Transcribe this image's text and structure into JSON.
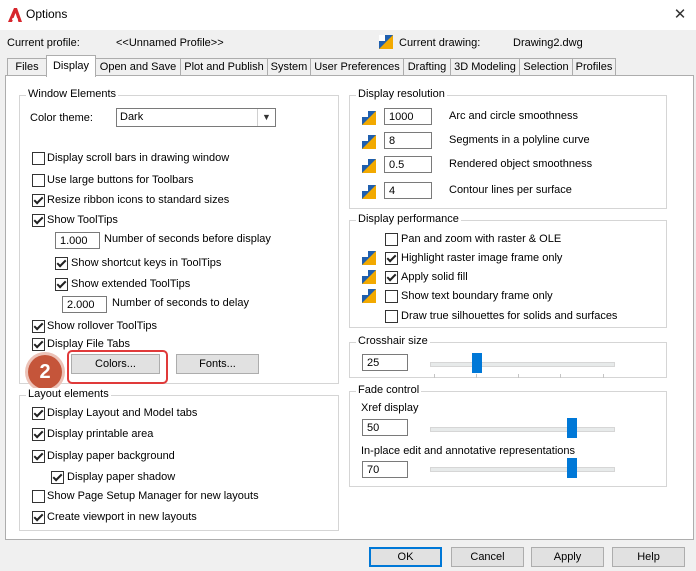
{
  "window": {
    "title": "Options",
    "close_glyph": "✕"
  },
  "profile": {
    "label": "Current profile:",
    "value": "<<Unnamed Profile>>",
    "drawing_label": "Current drawing:",
    "drawing_value": "Drawing2.dwg"
  },
  "tabs": [
    {
      "label": "Files"
    },
    {
      "label": "Display"
    },
    {
      "label": "Open and Save"
    },
    {
      "label": "Plot and Publish"
    },
    {
      "label": "System"
    },
    {
      "label": "User Preferences"
    },
    {
      "label": "Drafting"
    },
    {
      "label": "3D Modeling"
    },
    {
      "label": "Selection"
    },
    {
      "label": "Profiles"
    }
  ],
  "active_tab": "Display",
  "window_elements": {
    "title": "Window Elements",
    "color_theme_label": "Color theme:",
    "color_theme_value": "Dark",
    "items": [
      {
        "label": "Display scroll bars in drawing window",
        "checked": false
      },
      {
        "label": "Use large buttons for Toolbars",
        "checked": false
      },
      {
        "label": "Resize ribbon icons to standard sizes",
        "checked": true
      },
      {
        "label": "Show ToolTips",
        "checked": true
      }
    ],
    "tooltip_delay_value": "1.000",
    "tooltip_delay_label": "Number of seconds before display",
    "shortcut_keys_label": "Show shortcut keys in ToolTips",
    "extended_tooltips_label": "Show extended ToolTips",
    "extended_delay_value": "2.000",
    "extended_delay_label": "Number of seconds to delay",
    "rollover_label": "Show rollover ToolTips",
    "file_tabs_label": "Display File Tabs",
    "colors_button": "Colors...",
    "fonts_button": "Fonts..."
  },
  "layout_elements": {
    "title": "Layout elements",
    "items": [
      {
        "label": "Display Layout and Model tabs"
      },
      {
        "label": "Display printable area"
      },
      {
        "label": "Display paper background"
      },
      {
        "label": "Display paper shadow"
      },
      {
        "label": "Show Page Setup Manager for new layouts"
      },
      {
        "label": "Create viewport in new layouts"
      }
    ]
  },
  "display_resolution": {
    "title": "Display resolution",
    "items": [
      {
        "value": "1000",
        "label": "Arc and circle smoothness"
      },
      {
        "value": "8",
        "label": "Segments in a polyline curve"
      },
      {
        "value": "0.5",
        "label": "Rendered object smoothness"
      },
      {
        "value": "4",
        "label": "Contour lines per surface"
      }
    ]
  },
  "display_performance": {
    "title": "Display performance",
    "items": [
      {
        "label": "Pan and zoom with raster & OLE",
        "checked": false
      },
      {
        "label": "Highlight raster image frame only",
        "checked": true
      },
      {
        "label": "Apply solid fill",
        "checked": true
      },
      {
        "label": "Show text boundary frame only",
        "checked": false
      },
      {
        "label": "Draw true silhouettes for solids and surfaces",
        "checked": false
      }
    ]
  },
  "crosshair": {
    "title": "Crosshair size",
    "value": "25",
    "level_percent": 25
  },
  "fade_control": {
    "title": "Fade control",
    "xref_label": "Xref display",
    "xref_value": "50",
    "inplace_label": "In-place edit and annotative representations",
    "inplace_value": "70"
  },
  "buttons": {
    "ok": "OK",
    "cancel": "Cancel",
    "apply": "Apply",
    "help": "Help"
  },
  "annotation": {
    "step_number": "2"
  },
  "colors": {
    "accent": "#0078d7",
    "highlight_ring": "#e03a3a",
    "badge": "#c5553a"
  }
}
